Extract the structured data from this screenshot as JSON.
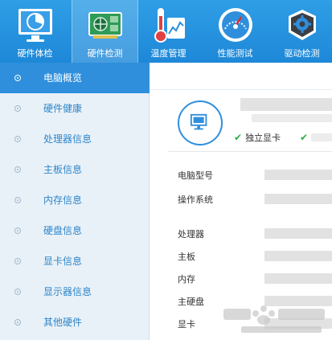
{
  "toolbar": {
    "items": [
      {
        "label": "硬件体检",
        "icon": "monitor-chart-icon"
      },
      {
        "label": "硬件检测",
        "icon": "graphics-card-icon"
      },
      {
        "label": "温度管理",
        "icon": "thermometer-icon"
      },
      {
        "label": "性能测试",
        "icon": "speedometer-icon"
      },
      {
        "label": "驱动检测",
        "icon": "gear-box-icon"
      }
    ],
    "active_index": 1
  },
  "sidebar": {
    "items": [
      {
        "label": "电脑概览"
      },
      {
        "label": "硬件健康"
      },
      {
        "label": "处理器信息"
      },
      {
        "label": "主板信息"
      },
      {
        "label": "内存信息"
      },
      {
        "label": "硬盘信息"
      },
      {
        "label": "显卡信息"
      },
      {
        "label": "显示器信息"
      },
      {
        "label": "其他硬件"
      }
    ],
    "active_index": 0
  },
  "overview": {
    "tags": [
      {
        "label": "独立显卡"
      },
      {
        "label": ""
      }
    ],
    "rows": [
      {
        "label": "电脑型号"
      },
      {
        "label": "操作系统"
      },
      {
        "label": "处理器"
      },
      {
        "label": "主板"
      },
      {
        "label": "内存"
      },
      {
        "label": "主硬盘"
      },
      {
        "label": "显卡"
      }
    ]
  },
  "colors": {
    "toolbar_bg": "#1e88d8",
    "sidebar_bg": "#e9f1f8",
    "active_blue": "#2f8fdc",
    "link_blue": "#2e86c8",
    "check_green": "#2cae3f"
  }
}
